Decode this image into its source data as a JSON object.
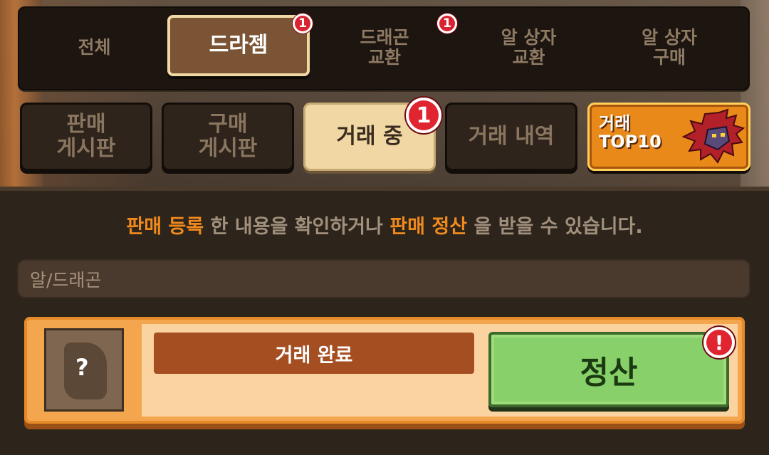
{
  "tabs": [
    {
      "label": "전체",
      "active": false,
      "badge": ""
    },
    {
      "label": "드라젬",
      "active": true,
      "badge": "1"
    },
    {
      "label": "드래곤\n교환",
      "active": false,
      "badge": "1"
    },
    {
      "label": "알 상자\n교환",
      "active": false,
      "badge": ""
    },
    {
      "label": "알 상자\n구매",
      "active": false,
      "badge": ""
    }
  ],
  "subtabs": [
    {
      "label": "판매\n게시판",
      "active": false
    },
    {
      "label": "구매\n게시판",
      "active": false
    },
    {
      "label": "거래 중",
      "active": true,
      "badge": "1"
    },
    {
      "label": "거래 내역",
      "active": false
    },
    {
      "label": "거래\nTOP10",
      "active": false
    }
  ],
  "info": {
    "part1": "판매 등록",
    "part2": " 한 내용을 확인하거나 ",
    "part3": "판매 정산",
    "part4": " 을 받을 수 있습니다."
  },
  "search": {
    "placeholder": "알/드래곤"
  },
  "trade": {
    "thumb_label": "?",
    "status": "거래 완료",
    "settle_label": "정산",
    "alert_badge": "!"
  },
  "colors": {
    "highlight": "#f08a1c",
    "badge_red": "#e02530",
    "settle_green": "#88d069"
  }
}
